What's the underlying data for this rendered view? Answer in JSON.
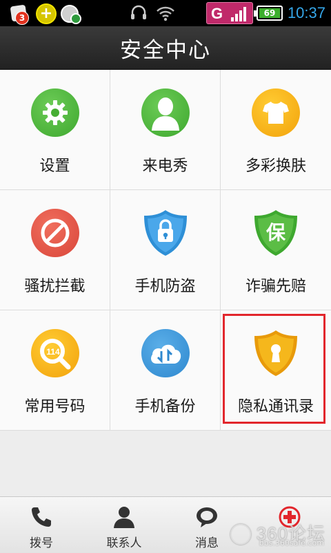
{
  "status_bar": {
    "notification_badge": "3",
    "network_type": "G",
    "battery_level": "69",
    "time": "10:37"
  },
  "header": {
    "title": "安全中心"
  },
  "grid_items": [
    {
      "label": "设置",
      "icon": "gear-icon",
      "color": "#4cb63a"
    },
    {
      "label": "来电秀",
      "icon": "person-icon",
      "color": "#4cb63a"
    },
    {
      "label": "多彩换肤",
      "icon": "tshirt-icon",
      "color": "#f5ad14"
    },
    {
      "label": "骚扰拦截",
      "icon": "block-icon",
      "color": "#e05646"
    },
    {
      "label": "手机防盗",
      "icon": "lock-shield-icon",
      "color": "#2e8fd6"
    },
    {
      "label": "诈骗先赔",
      "icon": "guarantee-shield-icon",
      "color": "#4cb63a",
      "glyph": "保"
    },
    {
      "label": "常用号码",
      "icon": "phone-number-icon",
      "color": "#f5ad14",
      "glyph": "114"
    },
    {
      "label": "手机备份",
      "icon": "cloud-sync-icon",
      "color": "#2e8fd6"
    },
    {
      "label": "隐私通讯录",
      "icon": "keyhole-shield-icon",
      "color": "#f5ad14",
      "highlighted": true
    }
  ],
  "bottom_nav": [
    {
      "label": "拨号",
      "icon": "phone-icon"
    },
    {
      "label": "联系人",
      "icon": "contact-icon"
    },
    {
      "label": "消息",
      "icon": "message-icon"
    },
    {
      "label": "",
      "icon": "plus-circle-icon",
      "color": "#e2262c"
    }
  ],
  "watermark": {
    "logo_text": "360论坛",
    "url": "bbs.360safe.com"
  }
}
